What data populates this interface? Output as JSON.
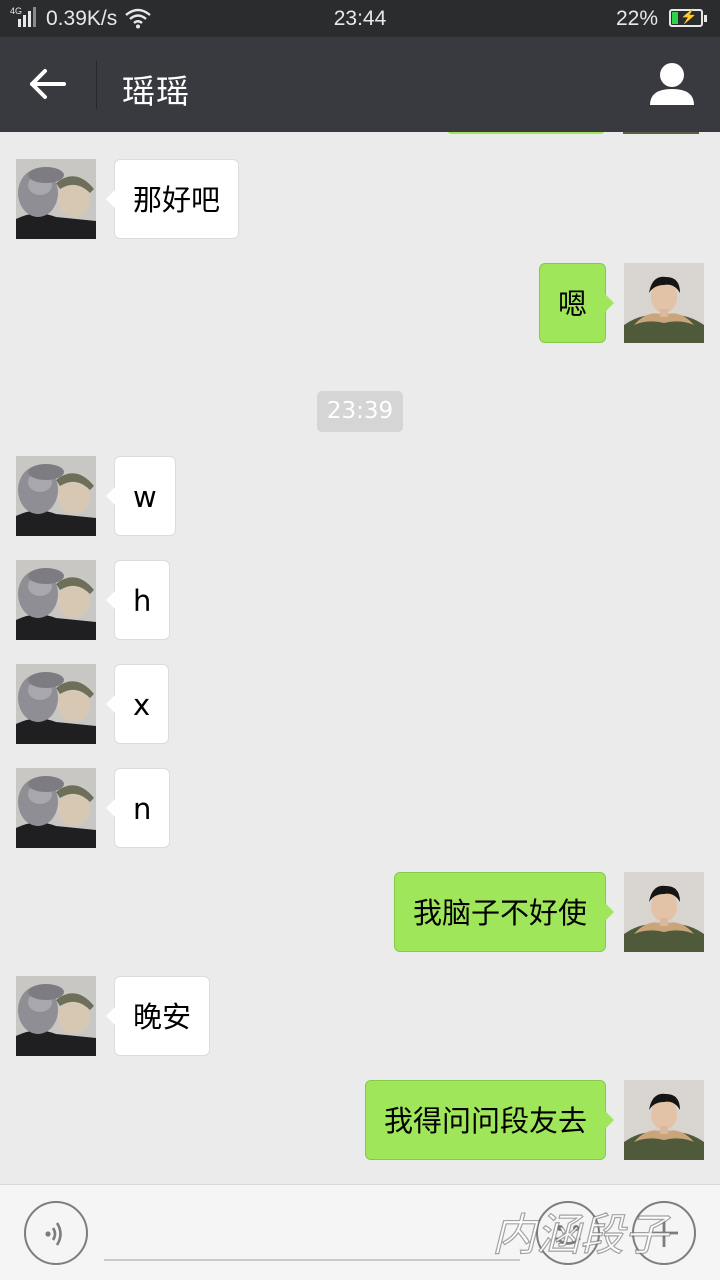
{
  "status_bar": {
    "network": "4G",
    "speed": "0.39K/s",
    "time": "23:44",
    "battery_percent": "22%",
    "battery_level": 0.22,
    "charging": true
  },
  "header": {
    "title": "瑶瑶",
    "back_icon": "arrow-left-icon",
    "profile_icon": "person-icon"
  },
  "messages": [
    {
      "from": "them",
      "text": "那好吧"
    },
    {
      "from": "me",
      "text": "嗯"
    },
    {
      "from": "them",
      "text": "w"
    },
    {
      "from": "them",
      "text": "h"
    },
    {
      "from": "them",
      "text": "x"
    },
    {
      "from": "them",
      "text": "n"
    },
    {
      "from": "me",
      "text": "我脑子不好使"
    },
    {
      "from": "them",
      "text": "晚安"
    },
    {
      "from": "me",
      "text": "我得问问段友去"
    }
  ],
  "timestamp": "23:39",
  "input": {
    "value": "",
    "voice_icon": "voice-icon",
    "emoji_icon": "emoji-icon",
    "plus_icon": "plus-icon"
  },
  "watermark": "内涵段子",
  "colors": {
    "title_bar": "#393a3f",
    "status_bar": "#2a2c2e",
    "chat_background": "#ebebeb",
    "outgoing_bubble": "#9fe65a",
    "incoming_bubble": "#ffffff",
    "battery_fill": "#2fd04a"
  }
}
